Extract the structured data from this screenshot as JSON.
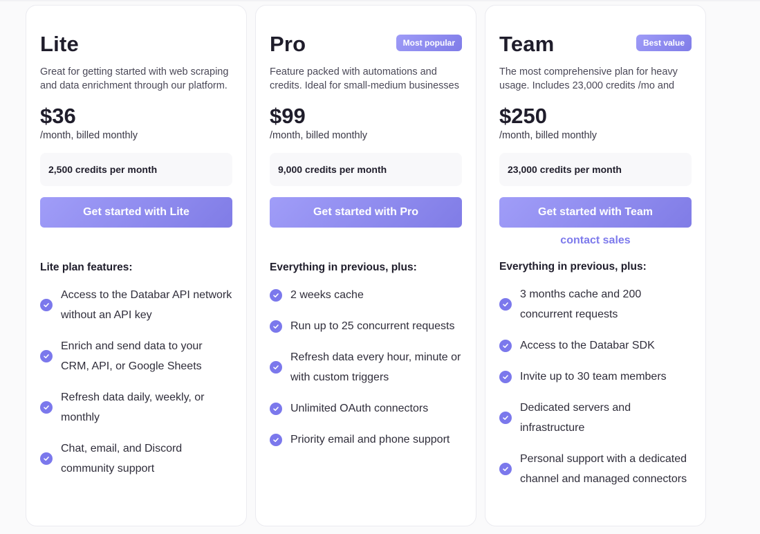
{
  "colors": {
    "accent": "#7b78ec",
    "button_gradient_start": "#a09df8",
    "button_gradient_end": "#807ce6",
    "page_background": "#fafafb",
    "card_background": "#ffffff",
    "credits_box_background": "#f8f8fa",
    "heading_text": "#1f1d2b"
  },
  "plans": [
    {
      "name": "Lite",
      "badge": null,
      "description": "Great for getting started with web scraping and data enrichment through our platform.",
      "price": "$36",
      "billing": "/month, billed monthly",
      "credits": "2,500 credits per month",
      "cta_label": "Get started with Lite",
      "contact_label": null,
      "features_title": "Lite plan features:",
      "features": [
        "Access to the Databar API network without an API key",
        "Enrich and send data to your CRM, API, or Google Sheets",
        "Refresh data daily, weekly, or monthly",
        "Chat, email, and Discord community support"
      ]
    },
    {
      "name": "Pro",
      "badge": "Most popular",
      "description": "Feature packed with automations and credits. Ideal for small-medium businesses",
      "price": "$99",
      "billing": "/month, billed monthly",
      "credits": "9,000 credits per month",
      "cta_label": "Get started with Pro",
      "contact_label": null,
      "features_title": "Everything in previous, plus:",
      "features": [
        "2 weeks cache",
        "Run up to 25 concurrent requests",
        "Refresh data every hour, minute or with custom triggers",
        "Unlimited OAuth connectors",
        "Priority email and phone support"
      ]
    },
    {
      "name": "Team",
      "badge": "Best value",
      "description": "The most comprehensive plan for heavy usage. Includes 23,000 credits /mo and",
      "price": "$250",
      "billing": "/month, billed monthly",
      "credits": "23,000 credits per month",
      "cta_label": "Get started with Team",
      "contact_label": "contact sales",
      "features_title": "Everything in previous, plus:",
      "features": [
        "3 months cache and 200 concurrent requests",
        "Access to the Databar SDK",
        "Invite up to 30 team members",
        "Dedicated servers and infrastructure",
        "Personal support with a dedicated channel and managed connectors"
      ]
    }
  ],
  "icons": {
    "feature_bullet": "check-circle-icon"
  }
}
